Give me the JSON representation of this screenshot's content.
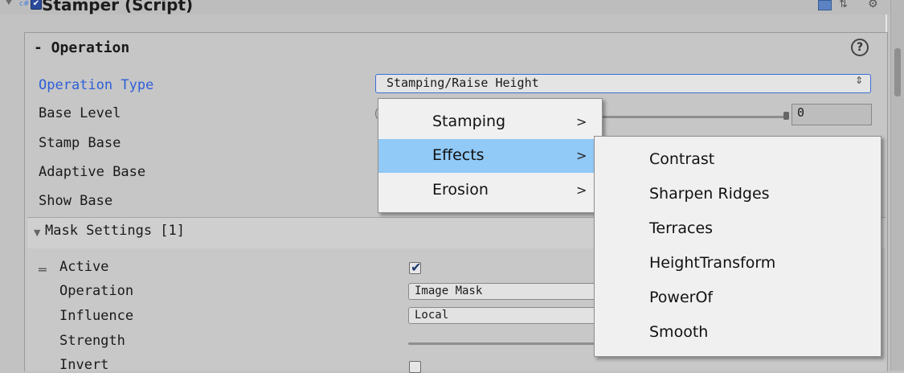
{
  "header": {
    "title": "Stamper (Script)",
    "script_icon_text": "c#",
    "enabled_checked": true
  },
  "operation_section": {
    "title": "- Operation",
    "help_glyph": "?",
    "rows": {
      "operation_type_label": "Operation Type",
      "base_level_label": "Base Level",
      "stamp_base_label": "Stamp Base",
      "adaptive_base_label": "Adaptive Base",
      "show_base_label": "Show Base"
    },
    "operation_type_value": "Stamping/Raise Height",
    "dropdown_arrows": "⇕",
    "base_level_value": "0"
  },
  "mask_settings": {
    "header_label": "Mask Settings [1]",
    "rows": {
      "active_label": "Active",
      "operation_label": "Operation",
      "influence_label": "Influence",
      "strength_label": "Strength",
      "invert_label": "Invert"
    },
    "active_checked": true,
    "operation_value": "Image Mask",
    "influence_value": "Local",
    "invert_checked": false
  },
  "context_menu": {
    "items": [
      {
        "label": "Stamping",
        "arrow": ">",
        "highlighted": false
      },
      {
        "label": "Effects",
        "arrow": ">",
        "highlighted": true
      },
      {
        "label": "Erosion",
        "arrow": ">",
        "highlighted": false
      }
    ]
  },
  "submenu": {
    "items": [
      "Contrast",
      "Sharpen Ridges",
      "Terraces",
      "HeightTransform",
      "PowerOf",
      "Smooth"
    ]
  },
  "colors": {
    "highlight": "#91c9f7",
    "link_blue": "#2e5fd8",
    "panel_bg": "#c6c6c6"
  }
}
